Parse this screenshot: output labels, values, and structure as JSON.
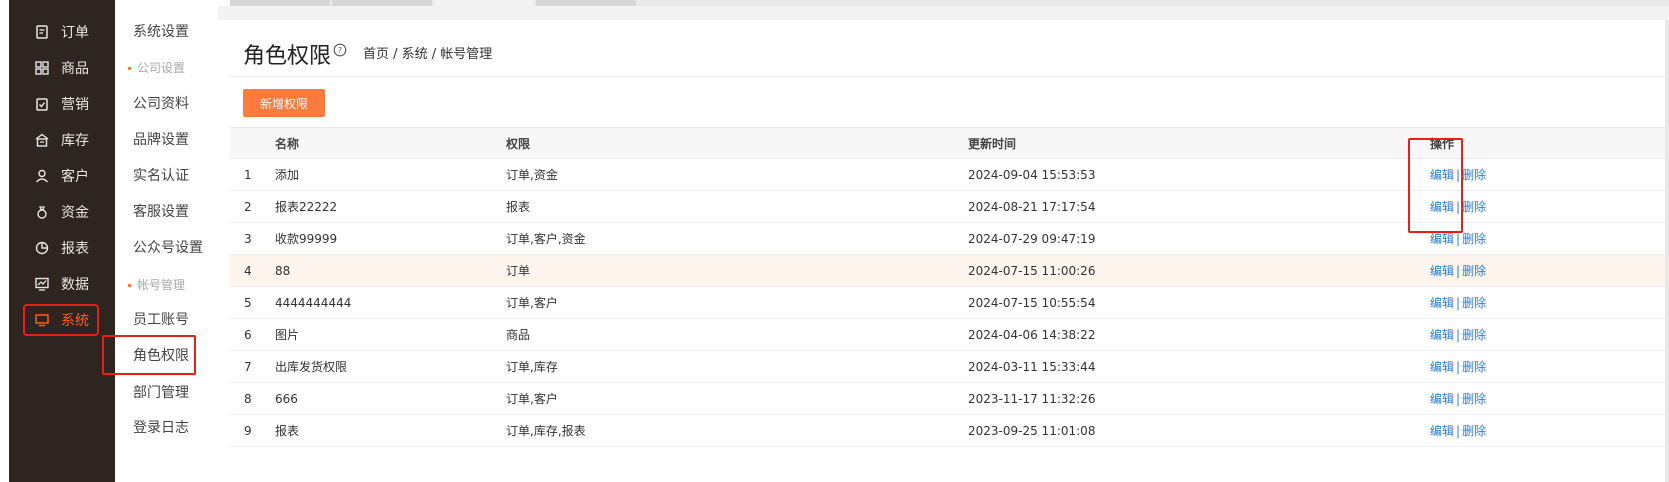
{
  "sidebar": {
    "items": [
      {
        "label": "订单",
        "icon": "order-icon"
      },
      {
        "label": "商品",
        "icon": "grid-icon"
      },
      {
        "label": "营销",
        "icon": "badge-icon"
      },
      {
        "label": "库存",
        "icon": "warehouse-icon"
      },
      {
        "label": "客户",
        "icon": "user-icon"
      },
      {
        "label": "资金",
        "icon": "money-bag-icon"
      },
      {
        "label": "报表",
        "icon": "pie-chart-icon"
      },
      {
        "label": "数据",
        "icon": "data-chart-icon"
      },
      {
        "label": "系统",
        "icon": "monitor-icon",
        "active": true
      }
    ]
  },
  "subnav": {
    "system_settings": "系统设置",
    "group_company": "公司设置",
    "company_profile": "公司资料",
    "brand_settings": "品牌设置",
    "real_name": "实名认证",
    "service_settings": "客服设置",
    "official_account": "公众号设置",
    "group_account": "帐号管理",
    "staff_account": "员工账号",
    "role_permission": "角色权限",
    "department": "部门管理",
    "login_log": "登录日志"
  },
  "page": {
    "title": "角色权限",
    "breadcrumb": "首页 / 系统 / 帐号管理",
    "add_button": "新增权限"
  },
  "table": {
    "headers": {
      "name": "名称",
      "permission": "权限",
      "updated": "更新时间",
      "ops": "操作"
    },
    "edit_label": "编辑",
    "delete_label": "删除",
    "sep": "|",
    "rows": [
      {
        "idx": "1",
        "name": "添加",
        "permission": "订单,资金",
        "updated": "2024-09-04 15:53:53"
      },
      {
        "idx": "2",
        "name": "报表22222",
        "permission": "报表",
        "updated": "2024-08-21 17:17:54"
      },
      {
        "idx": "3",
        "name": "收款99999",
        "permission": "订单,客户,资金",
        "updated": "2024-07-29 09:47:19"
      },
      {
        "idx": "4",
        "name": "88",
        "permission": "订单",
        "updated": "2024-07-15 11:00:26"
      },
      {
        "idx": "5",
        "name": "4444444444",
        "permission": "订单,客户",
        "updated": "2024-07-15 10:55:54"
      },
      {
        "idx": "6",
        "name": "图片",
        "permission": "商品",
        "updated": "2024-04-06 14:38:22"
      },
      {
        "idx": "7",
        "name": "出库发货权限",
        "permission": "订单,库存",
        "updated": "2024-03-11 15:33:44"
      },
      {
        "idx": "8",
        "name": "666",
        "permission": "订单,客户",
        "updated": "2023-11-17 11:32:26"
      },
      {
        "idx": "9",
        "name": "报表",
        "permission": "订单,库存,报表",
        "updated": "2023-09-25 11:01:08"
      }
    ]
  },
  "colors": {
    "accent": "#ff7a3d",
    "highlight": "#e32119",
    "link": "#2b7cd3",
    "sidebar_bg": "#2e2520"
  }
}
